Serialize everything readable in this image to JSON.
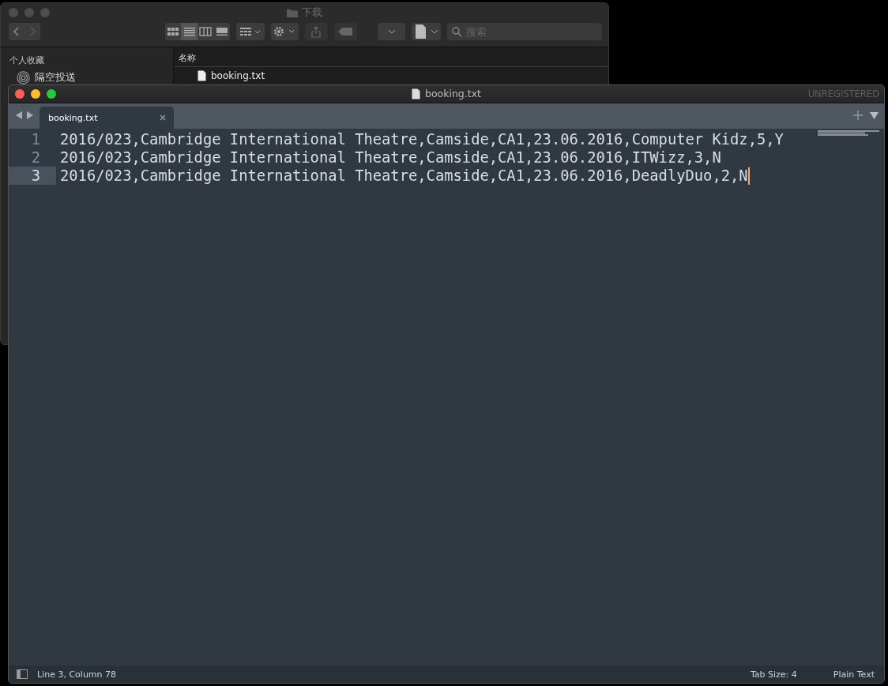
{
  "finder": {
    "title": "下载",
    "search": {
      "placeholder": "搜索"
    },
    "sidebar": {
      "heading": "个人收藏",
      "items": [
        {
          "label": "隔空投送"
        }
      ]
    },
    "list": {
      "column": "名称",
      "files": [
        {
          "name": "booking.txt"
        }
      ]
    }
  },
  "editor": {
    "title": "booking.txt",
    "badge": "UNREGISTERED",
    "tabs": [
      {
        "label": "booking.txt",
        "selected": true
      }
    ],
    "lines": [
      {
        "number": "1",
        "text": "2016/023,Cambridge International Theatre,Camside,CA1,23.06.2016,Computer Kidz,5,Y",
        "current": false
      },
      {
        "number": "2",
        "text": "2016/023,Cambridge International Theatre,Camside,CA1,23.06.2016,ITWizz,3,N",
        "current": false
      },
      {
        "number": "3",
        "text": "2016/023,Cambridge International Theatre,Camside,CA1,23.06.2016,DeadlyDuo,2,N",
        "current": true
      }
    ],
    "status_bar": {
      "position": "Line 3, Column 78",
      "tab_size": "Tab Size: 4",
      "syntax": "Plain Text"
    }
  }
}
